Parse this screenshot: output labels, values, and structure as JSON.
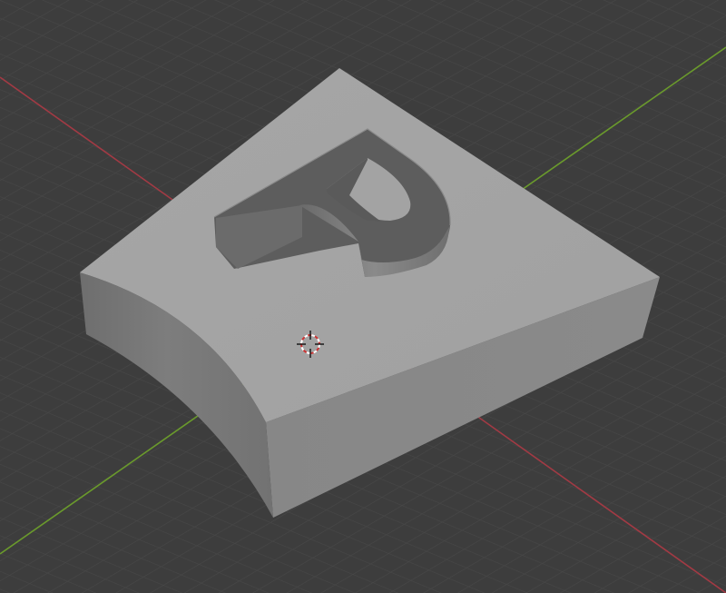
{
  "viewport": {
    "background_color": "#3d3d3d",
    "grid_minor_color": "#474747",
    "grid_major_color": "#505050"
  },
  "axes": {
    "x_axis_color": "#a23a44",
    "y_axis_color": "#6a9a2c"
  },
  "mesh": {
    "top_face_color": "#a4a4a4",
    "front_face_color": "#8d8d8d",
    "left_face_color": "#777777",
    "letter_engraved": "P",
    "letter_wall_light": "#747474",
    "letter_wall_dark": "#5b5b5b"
  },
  "cursor_3d": {
    "icon": "3d-cursor-icon",
    "ring_color_a": "#ffffff",
    "ring_color_b": "#cc3333",
    "cross_color": "#111111"
  }
}
